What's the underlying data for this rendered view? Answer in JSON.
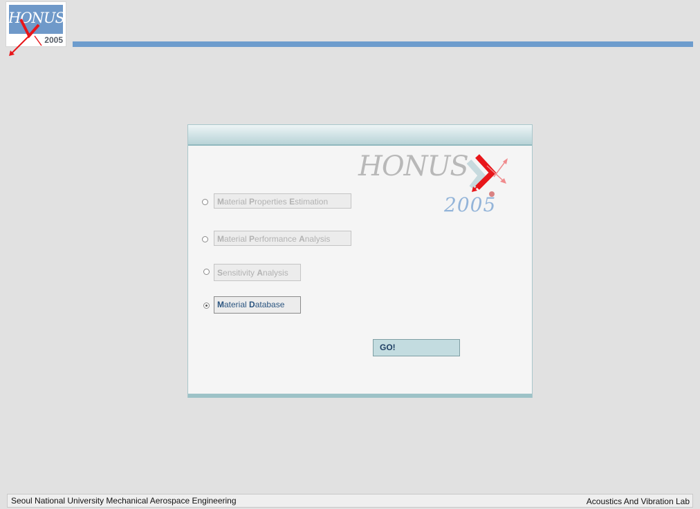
{
  "header": {
    "logo": {
      "text": "HONUS",
      "year": "2005",
      "icon": "honus-logo-icon"
    },
    "bar_color": "#6d9ccd"
  },
  "panel": {
    "brand_text": "HONUS",
    "brand_year": "2005",
    "options": [
      {
        "label_parts": [
          {
            "initial": "M",
            "rest": "aterial "
          },
          {
            "initial": "P",
            "rest": "roperties "
          },
          {
            "initial": "E",
            "rest": "stimation"
          }
        ],
        "label": "Material Properties Estimation",
        "enabled": false,
        "selected": false
      },
      {
        "label_parts": [
          {
            "initial": "M",
            "rest": "aterial "
          },
          {
            "initial": "P",
            "rest": "erformance "
          },
          {
            "initial": "A",
            "rest": "nalysis"
          }
        ],
        "label": "Material Performance Analysis",
        "enabled": false,
        "selected": false
      },
      {
        "label_parts": [
          {
            "initial": "S",
            "rest": "ensitivity "
          },
          {
            "initial": "A",
            "rest": "nalysis"
          }
        ],
        "label": "Sensitivity Analysis",
        "enabled": false,
        "selected": false
      },
      {
        "label_parts": [
          {
            "initial": "M",
            "rest": "aterial "
          },
          {
            "initial": "D",
            "rest": "atabase"
          }
        ],
        "label": "Material Database",
        "enabled": true,
        "selected": true
      }
    ],
    "go_label": "GO!"
  },
  "status": {
    "left": "Seoul National University Mechanical Aerospace Engineering",
    "right": "Acoustics And Vibration Lab"
  },
  "colors": {
    "accent": "#6d9ccd",
    "panel_border": "#a9c7cb",
    "go_button": "#c3dce0",
    "logo_red": "#e8161a"
  }
}
